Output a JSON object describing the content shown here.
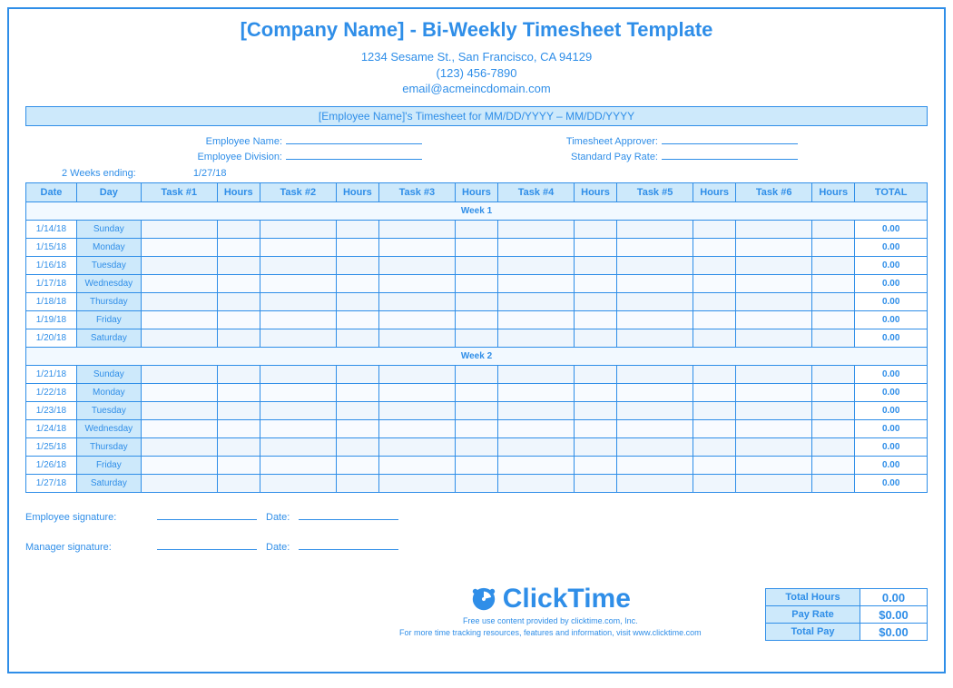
{
  "header": {
    "title": "[Company Name] - Bi-Weekly Timesheet Template",
    "address": "1234 Sesame St.,  San Francisco, CA 94129",
    "phone": "(123) 456-7890",
    "email": "email@acmeincdomain.com",
    "subtitle": "[Employee Name]'s Timesheet for MM/DD/YYYY – MM/DD/YYYY"
  },
  "fields": {
    "employee_name_label": "Employee Name:",
    "employee_division_label": "Employee Division:",
    "approver_label": "Timesheet Approver:",
    "payrate_label": "Standard Pay Rate:"
  },
  "ending_label": "2 Weeks ending:",
  "ending_value": "1/27/18",
  "columns": [
    "Date",
    "Day",
    "Task #1",
    "Hours",
    "Task #2",
    "Hours",
    "Task #3",
    "Hours",
    "Task #4",
    "Hours",
    "Task #5",
    "Hours",
    "Task #6",
    "Hours",
    "TOTAL"
  ],
  "week1_label": "Week 1",
  "week2_label": "Week 2",
  "week1": [
    {
      "date": "1/14/18",
      "day": "Sunday",
      "total": "0.00"
    },
    {
      "date": "1/15/18",
      "day": "Monday",
      "total": "0.00"
    },
    {
      "date": "1/16/18",
      "day": "Tuesday",
      "total": "0.00"
    },
    {
      "date": "1/17/18",
      "day": "Wednesday",
      "total": "0.00"
    },
    {
      "date": "1/18/18",
      "day": "Thursday",
      "total": "0.00"
    },
    {
      "date": "1/19/18",
      "day": "Friday",
      "total": "0.00"
    },
    {
      "date": "1/20/18",
      "day": "Saturday",
      "total": "0.00"
    }
  ],
  "week2": [
    {
      "date": "1/21/18",
      "day": "Sunday",
      "total": "0.00"
    },
    {
      "date": "1/22/18",
      "day": "Monday",
      "total": "0.00"
    },
    {
      "date": "1/23/18",
      "day": "Tuesday",
      "total": "0.00"
    },
    {
      "date": "1/24/18",
      "day": "Wednesday",
      "total": "0.00"
    },
    {
      "date": "1/25/18",
      "day": "Thursday",
      "total": "0.00"
    },
    {
      "date": "1/26/18",
      "day": "Friday",
      "total": "0.00"
    },
    {
      "date": "1/27/18",
      "day": "Saturday",
      "total": "0.00"
    }
  ],
  "summary": {
    "total_hours_label": "Total Hours",
    "total_hours_value": "0.00",
    "pay_rate_label": "Pay Rate",
    "pay_rate_value": "$0.00",
    "total_pay_label": "Total Pay",
    "total_pay_value": "$0.00"
  },
  "signatures": {
    "employee_label": "Employee signature:",
    "manager_label": "Manager signature:",
    "date_label": "Date:"
  },
  "brand": {
    "name": "ClickTime",
    "note1": "Free use content provided by clicktime.com, Inc.",
    "note2": "For more time tracking resources, features and information, visit www.clicktime.com"
  }
}
